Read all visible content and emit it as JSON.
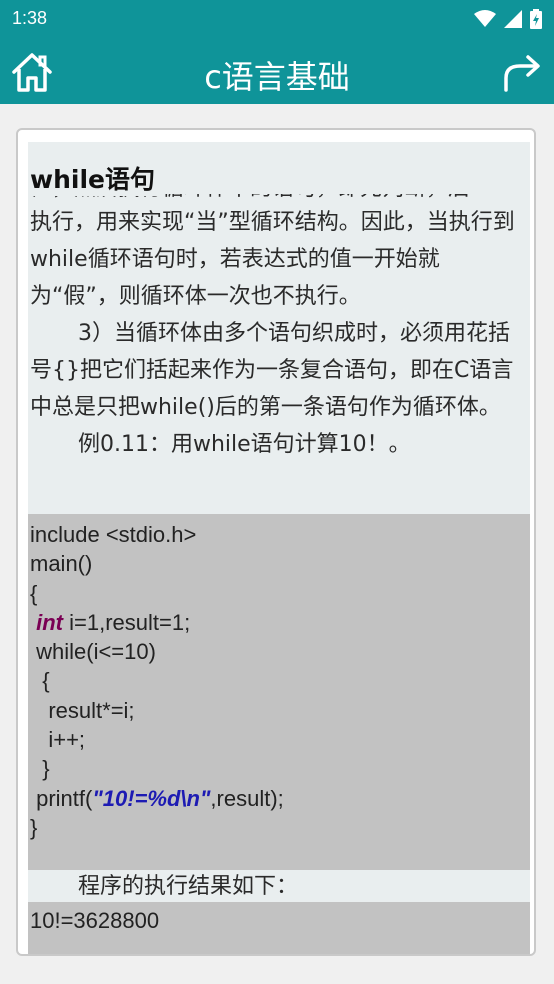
{
  "status": {
    "time": "1:38"
  },
  "appbar": {
    "title": "c语言基础"
  },
  "content": {
    "heading": "while语句",
    "partial_line": "值，然后执行循环体中的语句，即先判断，后",
    "para1": "执行，用来实现“当”型循环结构。因此，当执行到while循环语句时，若表达式的值一开始就为“假”，则循环体一次也不执行。",
    "para2": "3）当循环体由多个语句织成时，必须用花括号{}把它们括起来作为一条复合语句，即在C语言中总是只把while()后的第一条语句作为循环体。",
    "example": "例0.11：用while语句计算10！。",
    "code": {
      "l1": "include <stdio.h>",
      "l2": "main()",
      "l3": "{",
      "l4_kw": "int",
      "l4_rest": " i=1,result=1;",
      "l5": " while(i<=10)",
      "l6": "  {",
      "l7": "   result*=i;",
      "l8": "   i++;",
      "l9": "  }",
      "l10_a": " printf(",
      "l10_str": "\"10!=%d\\n\"",
      "l10_b": ",result);",
      "l11": "}"
    },
    "result_label": "程序的执行结果如下：",
    "result_value": "10!=3628800"
  }
}
